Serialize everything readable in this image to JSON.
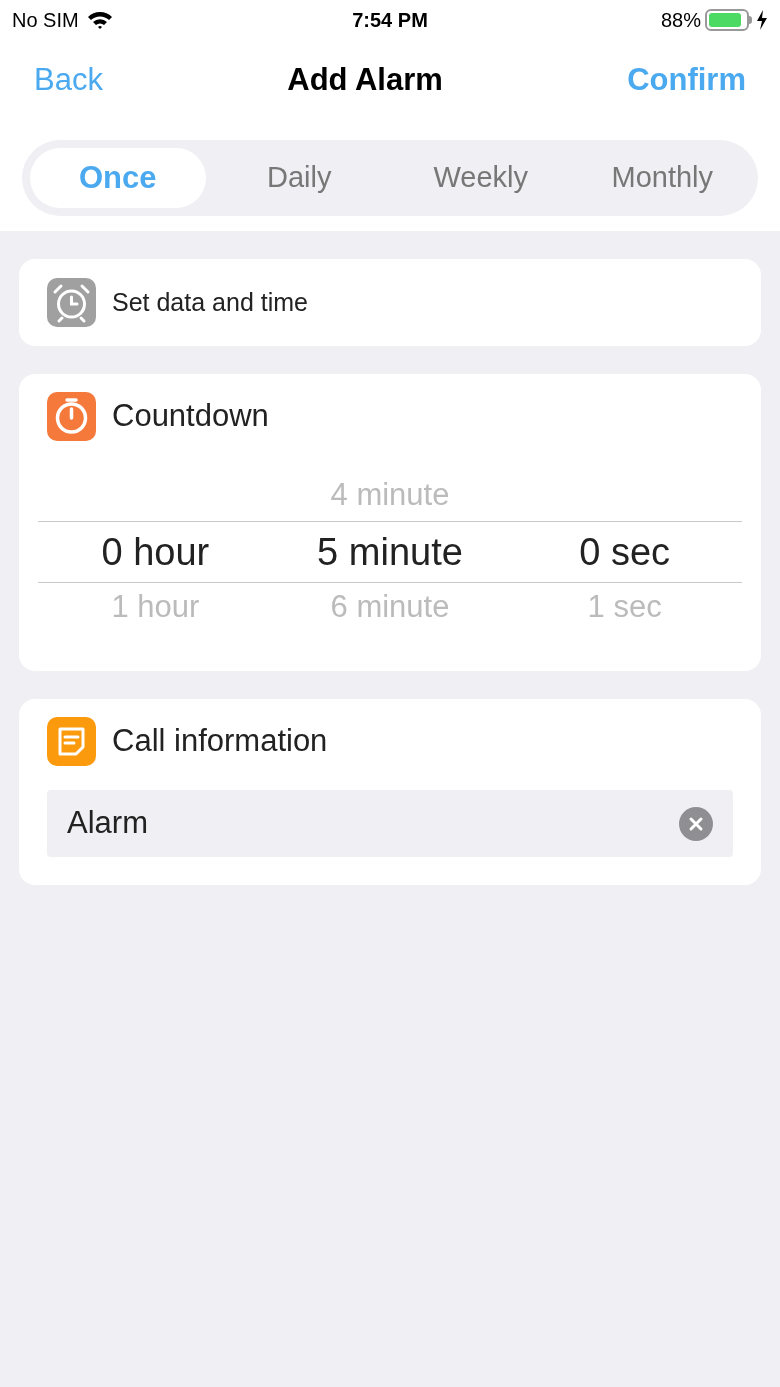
{
  "status_bar": {
    "carrier": "No SIM",
    "time": "7:54 PM",
    "battery": "88%",
    "charging": true
  },
  "nav": {
    "back": "Back",
    "title": "Add Alarm",
    "confirm": "Confirm"
  },
  "tabs": [
    {
      "label": "Once",
      "selected": true
    },
    {
      "label": "Daily",
      "selected": false
    },
    {
      "label": "Weekly",
      "selected": false
    },
    {
      "label": "Monthly",
      "selected": false
    }
  ],
  "date_time": {
    "label": "Set data and time"
  },
  "countdown": {
    "title": "Countdown",
    "picker": [
      {
        "value": "0 hour",
        "below": "1 hour"
      },
      {
        "above": "4 minute",
        "value": "5 minute",
        "below": "6 minute"
      },
      {
        "value": "0 sec",
        "below": "1 sec"
      }
    ]
  },
  "call_info": {
    "title": "Call information",
    "field": {
      "value": "Alarm"
    }
  }
}
